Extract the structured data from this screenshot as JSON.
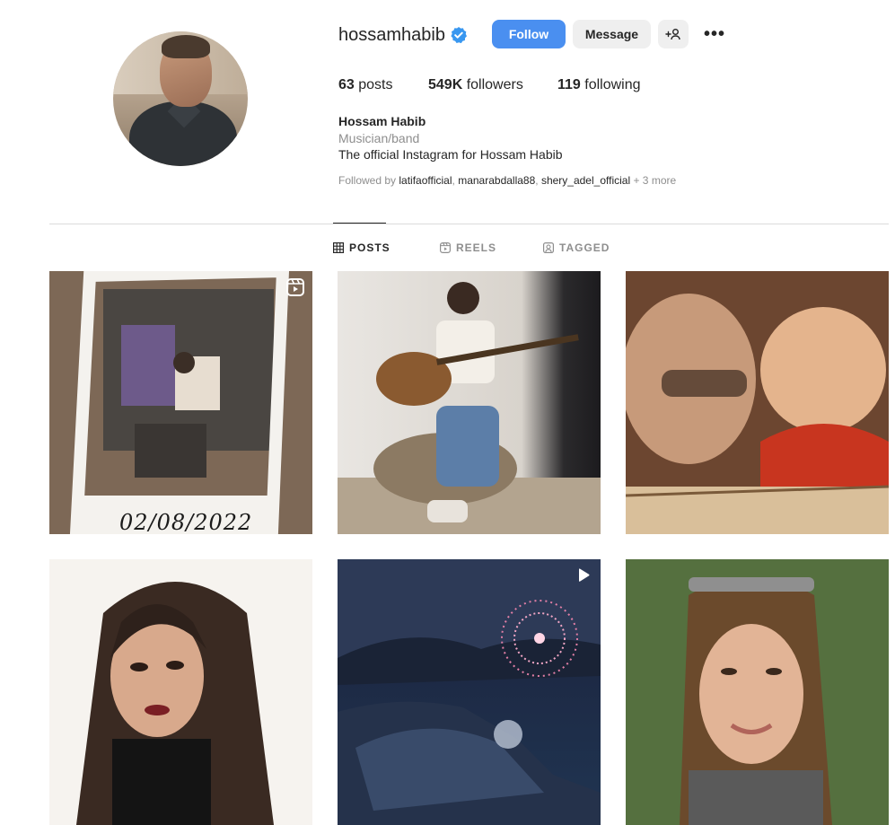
{
  "profile": {
    "username": "hossamhabib",
    "verified": true,
    "buttons": {
      "follow": "Follow",
      "message": "Message",
      "add_user": "+👤",
      "more": "•••"
    },
    "stats": {
      "posts_count": "63",
      "posts_label": "posts",
      "followers_count": "549K",
      "followers_label": "followers",
      "following_count": "119",
      "following_label": "following"
    },
    "full_name": "Hossam Habib",
    "category": "Musician/band",
    "bio": "The official Instagram for Hossam Habib",
    "followed_by": {
      "prefix": "Followed by",
      "accounts": [
        "latifaofficial",
        "manarabdalla88",
        "shery_adel_official"
      ],
      "more": "+ 3 more"
    }
  },
  "tabs": [
    {
      "label": "POSTS",
      "icon": "grid-icon",
      "active": true
    },
    {
      "label": "REELS",
      "icon": "reels-icon",
      "active": false
    },
    {
      "label": "TAGGED",
      "icon": "tagged-icon",
      "active": false
    }
  ],
  "posts": [
    {
      "type": "reel",
      "badge_icon": "reels-icon",
      "caption": "02/08/2022"
    },
    {
      "type": "image"
    },
    {
      "type": "image"
    },
    {
      "type": "image"
    },
    {
      "type": "video",
      "badge_icon": "play-icon"
    },
    {
      "type": "image"
    }
  ],
  "colors": {
    "accent": "#4a8ff0",
    "verified": "#3897f0",
    "muted": "#8e8e8e"
  }
}
